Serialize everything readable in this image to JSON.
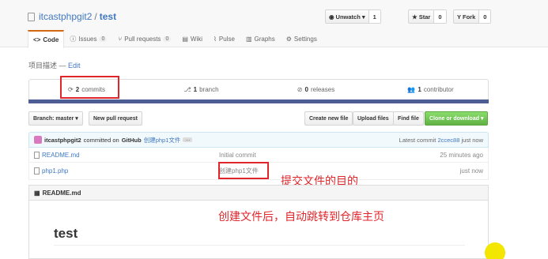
{
  "repo": {
    "owner": "itcastphpgit2",
    "separator": "/",
    "name": "test"
  },
  "header_buttons": {
    "watch": {
      "label": "Unwatch ▾",
      "count": "1"
    },
    "star": {
      "label": "Star",
      "count": "0"
    },
    "fork": {
      "label": "Fork",
      "count": "0"
    }
  },
  "tabs": [
    {
      "label": "Code",
      "count": ""
    },
    {
      "label": "Issues",
      "count": "0"
    },
    {
      "label": "Pull requests",
      "count": "0"
    },
    {
      "label": "Wiki",
      "count": ""
    },
    {
      "label": "Pulse",
      "count": ""
    },
    {
      "label": "Graphs",
      "count": ""
    },
    {
      "label": "Settings",
      "count": ""
    }
  ],
  "description": {
    "text": "项目描述 — ",
    "edit": "Edit"
  },
  "summary": {
    "commits": {
      "num": "2",
      "label": "commits"
    },
    "branches": {
      "num": "1",
      "label": "branch"
    },
    "releases": {
      "num": "0",
      "label": "releases"
    },
    "contributors": {
      "num": "1",
      "label": "contributor"
    }
  },
  "branch_bar": {
    "branch_select": "Branch: master ▾",
    "new_pr": "New pull request",
    "create_file": "Create new file",
    "upload_files": "Upload files",
    "find_file": "Find file",
    "clone": "Clone or download ▾"
  },
  "latest_commit": {
    "author": "itcastphpgit2",
    "text": "committed on",
    "via": "GitHub",
    "message": "创建php1文件",
    "ellipsis": "…",
    "meta_label": "Latest commit",
    "sha": "2ccec88",
    "age": "just now"
  },
  "files": [
    {
      "name": "README.md",
      "message": "Initial commit",
      "age": "25 minutes ago"
    },
    {
      "name": "php1.php",
      "message": "创建php1文件",
      "age": "just now"
    }
  ],
  "readme": {
    "header": "README.md",
    "title": "test"
  },
  "annotations": {
    "commit_purpose": "提交文件的目的",
    "after_create": "创建文件后，自动跳转到仓库主页"
  },
  "colors": {
    "accent": "#4078c0",
    "annotation": "#e0262b",
    "clone_button": "#6cc644",
    "language_bar": "#4f5d95"
  }
}
